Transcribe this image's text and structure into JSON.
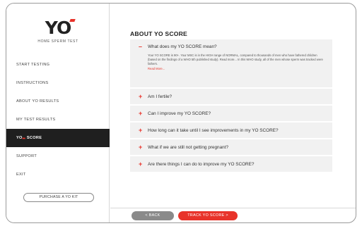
{
  "brand": {
    "logo_text": "YO",
    "subtitle": "HOME SPERM TEST",
    "accent_color": "#e8332a"
  },
  "sidebar": {
    "items": [
      {
        "label": "START TESTING",
        "active": false
      },
      {
        "label": "INSTRUCTIONS",
        "active": false
      },
      {
        "label": "ABOUT YO RESULTS",
        "active": false
      },
      {
        "label": "MY TEST RESULTS",
        "active": false
      },
      {
        "label_prefix": "YO",
        "label_suffix": "SCORE",
        "active": true
      },
      {
        "label": "SUPPORT",
        "active": false
      },
      {
        "label": "EXIT",
        "active": false
      }
    ],
    "purchase_label": "PURCHASE A YO KIT"
  },
  "main": {
    "title": "ABOUT YO SCORE",
    "faq": [
      {
        "question": "What does my YO SCORE mean?",
        "expanded": true,
        "answer": "Your YO SCORE is 90+. Your MSC is in the HIGH range of NORMAL, compared to thousands of men who have fathered children (based on the findings of a WHO 5th published study). Read more... In this WHO study, all of the men whose sperm was tracked were fathers.",
        "read_more": "Read More..."
      },
      {
        "question": "Am I fertile?",
        "expanded": false
      },
      {
        "question": "Can I improve my YO SCORE?",
        "expanded": false
      },
      {
        "question": "How long can it take until I see improvements in my YO SCORE?",
        "expanded": false
      },
      {
        "question": "What if we are still not getting pregnant?",
        "expanded": false
      },
      {
        "question": "Are there things I can do to improve my YO SCORE?",
        "expanded": false
      }
    ],
    "back_label": "< BACK",
    "track_label": "TRACK YO SCORE >"
  }
}
